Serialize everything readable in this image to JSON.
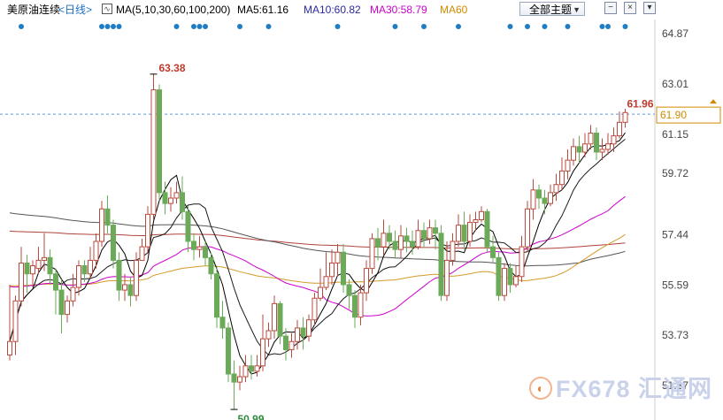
{
  "toolbar": {
    "symbol": "美原油连续",
    "period": "<日线>",
    "ma_definition": "MA(5,10,30,60,100,200)",
    "ma5": "MA5:61.16",
    "ma10": "MA10:60.82",
    "ma30": "MA30:58.79",
    "ma60": "MA60",
    "theme_selector": "全部主题",
    "theme_arrow_icon": "chevron-down-icon",
    "button_icons": [
      "minus-icon",
      "close-icon",
      "chevron-down-icon"
    ]
  },
  "colors": {
    "up": "#b94a3e",
    "down": "#6aaa58",
    "ma5": "#000000",
    "ma10": "#1a1a1a",
    "ma30": "#cc00cc",
    "ma60": "#d49a2a",
    "ma100": "#555555",
    "ma200": "#b0433a",
    "dots": "#1f7dc4",
    "price_line": "#5a9ad8",
    "axis_text": "#444444",
    "last_price_label": "#d08a00"
  },
  "chart_data": {
    "type": "candlestick",
    "y_axis_ticks": [
      64.87,
      63.01,
      61.15,
      59.72,
      57.44,
      55.59,
      53.73,
      51.87
    ],
    "ylim": [
      50.6,
      65.4
    ],
    "annotations": {
      "high": {
        "value": 63.38,
        "label": "63.38"
      },
      "low": {
        "value": 50.99,
        "label": "50.99"
      },
      "last": {
        "value": 61.96,
        "label": "61.96"
      },
      "current_price": {
        "value": 61.9,
        "label": "61.90"
      }
    },
    "candles": [
      [
        53.5,
        53.0,
        55.6,
        52.8
      ],
      [
        55.0,
        53.5,
        55.2,
        53.0
      ],
      [
        56.4,
        55.0,
        57.0,
        54.8
      ],
      [
        56.0,
        56.4,
        56.7,
        55.3
      ],
      [
        56.3,
        56.0,
        56.5,
        55.5
      ],
      [
        56.5,
        56.2,
        57.0,
        56.0
      ],
      [
        56.6,
        56.5,
        57.5,
        56.1
      ],
      [
        56.0,
        56.6,
        56.9,
        55.6
      ],
      [
        55.4,
        56.0,
        56.2,
        54.5
      ],
      [
        54.5,
        55.4,
        55.8,
        53.8
      ],
      [
        55.0,
        54.5,
        55.2,
        54.2
      ],
      [
        55.5,
        55.0,
        56.0,
        54.8
      ],
      [
        56.3,
        55.5,
        56.5,
        55.2
      ],
      [
        56.0,
        56.3,
        56.5,
        55.7
      ],
      [
        56.5,
        56.0,
        57.0,
        55.8
      ],
      [
        57.2,
        56.5,
        57.5,
        56.2
      ],
      [
        58.4,
        57.2,
        58.7,
        57.0
      ],
      [
        57.8,
        58.4,
        58.9,
        57.5
      ],
      [
        56.5,
        57.8,
        58.0,
        56.2
      ],
      [
        55.4,
        56.5,
        56.8,
        55.0
      ],
      [
        55.6,
        55.4,
        56.0,
        55.0
      ],
      [
        55.2,
        55.6,
        55.9,
        54.8
      ],
      [
        56.5,
        55.2,
        56.8,
        55.0
      ],
      [
        57.0,
        56.5,
        57.3,
        56.6
      ],
      [
        58.2,
        57.0,
        58.5,
        56.8
      ],
      [
        62.8,
        58.2,
        63.38,
        58.0
      ],
      [
        59.0,
        62.8,
        63.0,
        58.7
      ],
      [
        58.6,
        59.0,
        59.4,
        58.2
      ],
      [
        58.8,
        58.6,
        59.2,
        58.3
      ],
      [
        59.0,
        58.8,
        59.4,
        58.6
      ],
      [
        58.3,
        59.0,
        59.6,
        58.0
      ],
      [
        57.2,
        58.3,
        58.5,
        56.8
      ],
      [
        56.9,
        57.2,
        57.5,
        56.5
      ],
      [
        57.0,
        56.9,
        57.4,
        56.6
      ],
      [
        56.6,
        57.0,
        57.2,
        56.3
      ],
      [
        56.0,
        56.6,
        56.8,
        55.8
      ],
      [
        54.4,
        56.0,
        56.3,
        54.0
      ],
      [
        54.0,
        54.4,
        55.0,
        53.6
      ],
      [
        52.3,
        54.0,
        54.2,
        52.0
      ],
      [
        52.0,
        52.3,
        52.8,
        50.99
      ],
      [
        52.2,
        52.0,
        52.6,
        51.7
      ],
      [
        52.6,
        52.2,
        53.0,
        52.0
      ],
      [
        52.4,
        52.6,
        53.0,
        52.1
      ],
      [
        52.6,
        52.4,
        53.0,
        52.2
      ],
      [
        53.6,
        52.6,
        54.5,
        52.4
      ],
      [
        53.9,
        53.6,
        54.2,
        53.3
      ],
      [
        54.9,
        53.9,
        55.2,
        53.6
      ],
      [
        53.7,
        54.9,
        55.0,
        53.4
      ],
      [
        53.2,
        53.7,
        54.0,
        52.8
      ],
      [
        53.5,
        53.2,
        53.8,
        52.9
      ],
      [
        54.0,
        53.5,
        54.3,
        53.2
      ],
      [
        53.7,
        54.0,
        54.4,
        53.2
      ],
      [
        54.3,
        53.7,
        54.5,
        53.5
      ],
      [
        55.1,
        54.3,
        55.3,
        54.1
      ],
      [
        55.5,
        55.1,
        56.2,
        55.0
      ],
      [
        55.9,
        55.5,
        56.8,
        55.4
      ],
      [
        56.4,
        55.9,
        56.9,
        55.6
      ],
      [
        56.8,
        56.4,
        57.1,
        55.9
      ],
      [
        55.6,
        56.8,
        57.1,
        55.3
      ],
      [
        55.2,
        55.6,
        55.8,
        54.7
      ],
      [
        54.4,
        55.2,
        55.4,
        54.0
      ],
      [
        55.3,
        54.4,
        55.6,
        54.1
      ],
      [
        56.2,
        55.3,
        56.5,
        55.0
      ],
      [
        57.3,
        56.2,
        57.5,
        56.0
      ],
      [
        57.0,
        57.3,
        57.7,
        56.5
      ],
      [
        57.5,
        57.0,
        58.0,
        56.7
      ],
      [
        57.2,
        57.5,
        57.8,
        56.9
      ],
      [
        56.9,
        57.2,
        57.6,
        56.6
      ],
      [
        57.4,
        56.9,
        57.8,
        56.6
      ],
      [
        57.2,
        57.4,
        57.7,
        56.8
      ],
      [
        57.0,
        57.2,
        57.6,
        56.7
      ],
      [
        57.6,
        57.0,
        58.0,
        56.9
      ],
      [
        57.3,
        57.6,
        57.9,
        57.0
      ],
      [
        57.7,
        57.3,
        58.0,
        57.1
      ],
      [
        57.5,
        57.7,
        58.0,
        56.9
      ],
      [
        55.2,
        57.5,
        57.8,
        55.0
      ],
      [
        56.5,
        55.2,
        57.2,
        55.0
      ],
      [
        57.2,
        56.5,
        57.5,
        56.3
      ],
      [
        57.8,
        57.2,
        58.2,
        57.0
      ],
      [
        57.2,
        57.8,
        58.3,
        56.9
      ],
      [
        57.9,
        57.2,
        58.2,
        57.0
      ],
      [
        58.0,
        57.9,
        58.3,
        57.6
      ],
      [
        58.3,
        58.0,
        58.5,
        57.9
      ],
      [
        57.0,
        58.3,
        58.4,
        56.8
      ],
      [
        56.6,
        57.0,
        57.4,
        56.4
      ],
      [
        55.2,
        56.6,
        56.8,
        55.0
      ],
      [
        56.2,
        55.2,
        56.4,
        55.0
      ],
      [
        55.6,
        56.2,
        56.4,
        55.3
      ],
      [
        55.9,
        55.6,
        56.3,
        55.5
      ],
      [
        57.0,
        55.9,
        57.4,
        55.7
      ],
      [
        58.4,
        57.0,
        58.7,
        56.8
      ],
      [
        59.1,
        58.4,
        59.5,
        58.0
      ],
      [
        58.8,
        59.1,
        59.3,
        58.4
      ],
      [
        58.6,
        58.8,
        59.1,
        58.2
      ],
      [
        59.0,
        58.6,
        59.3,
        58.5
      ],
      [
        59.3,
        59.0,
        59.7,
        58.7
      ],
      [
        59.8,
        59.3,
        60.3,
        59.1
      ],
      [
        60.2,
        59.8,
        60.6,
        59.5
      ],
      [
        60.7,
        60.2,
        61.0,
        60.0
      ],
      [
        60.5,
        60.7,
        61.1,
        60.1
      ],
      [
        60.8,
        60.5,
        61.2,
        60.3
      ],
      [
        61.2,
        60.8,
        61.5,
        60.6
      ],
      [
        60.5,
        61.2,
        61.4,
        60.2
      ],
      [
        60.6,
        60.5,
        61.0,
        60.2
      ],
      [
        60.8,
        60.6,
        61.2,
        60.4
      ],
      [
        61.1,
        60.8,
        61.4,
        60.5
      ],
      [
        61.6,
        61.1,
        62.0,
        61.0
      ],
      [
        61.96,
        61.6,
        62.1,
        61.4
      ]
    ]
  }
}
